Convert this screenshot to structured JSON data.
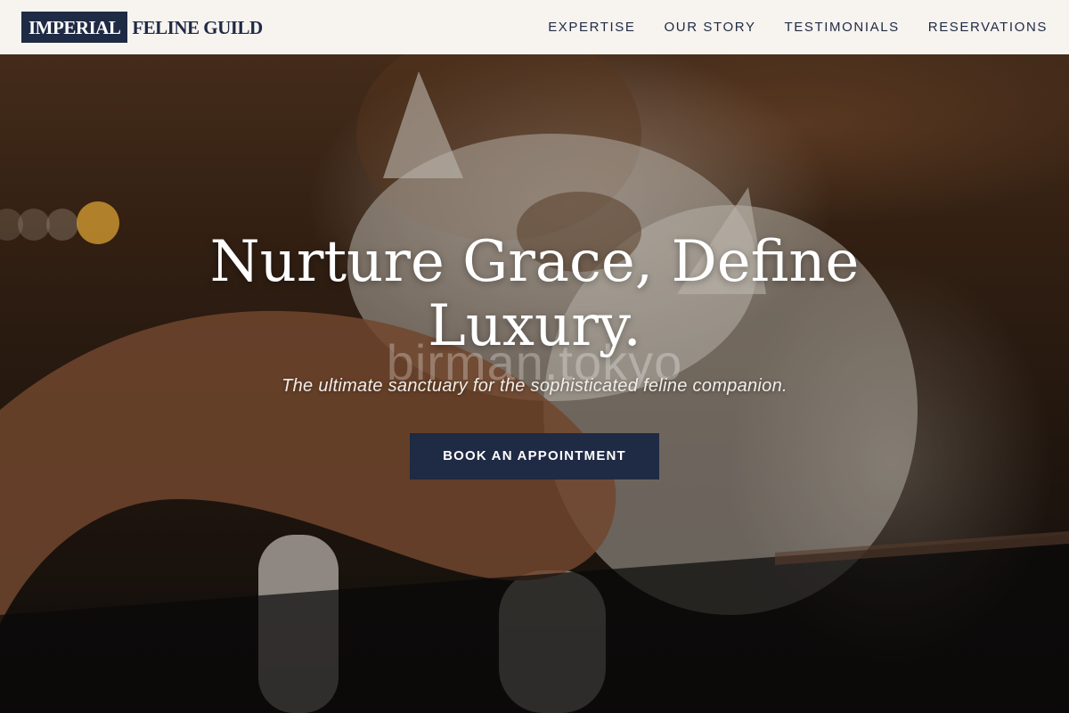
{
  "header": {
    "logo_box": "IMPERIAL",
    "logo_text": "FELINE GUILD",
    "nav": [
      {
        "label": "EXPERTISE"
      },
      {
        "label": "OUR STORY"
      },
      {
        "label": "TESTIMONIALS"
      },
      {
        "label": "RESERVATIONS"
      }
    ]
  },
  "hero": {
    "title_line1": "Nurture Grace, Define",
    "title_line2": "Luxury.",
    "subtitle": "The ultimate sanctuary for the sophisticated feline companion.",
    "watermark": "birman.tokyo",
    "cta_label": "BOOK AN APPOINTMENT"
  },
  "colors": {
    "navy": "#1f2a44",
    "header_bg": "#f7f3ef",
    "text_light": "#ffffff"
  }
}
